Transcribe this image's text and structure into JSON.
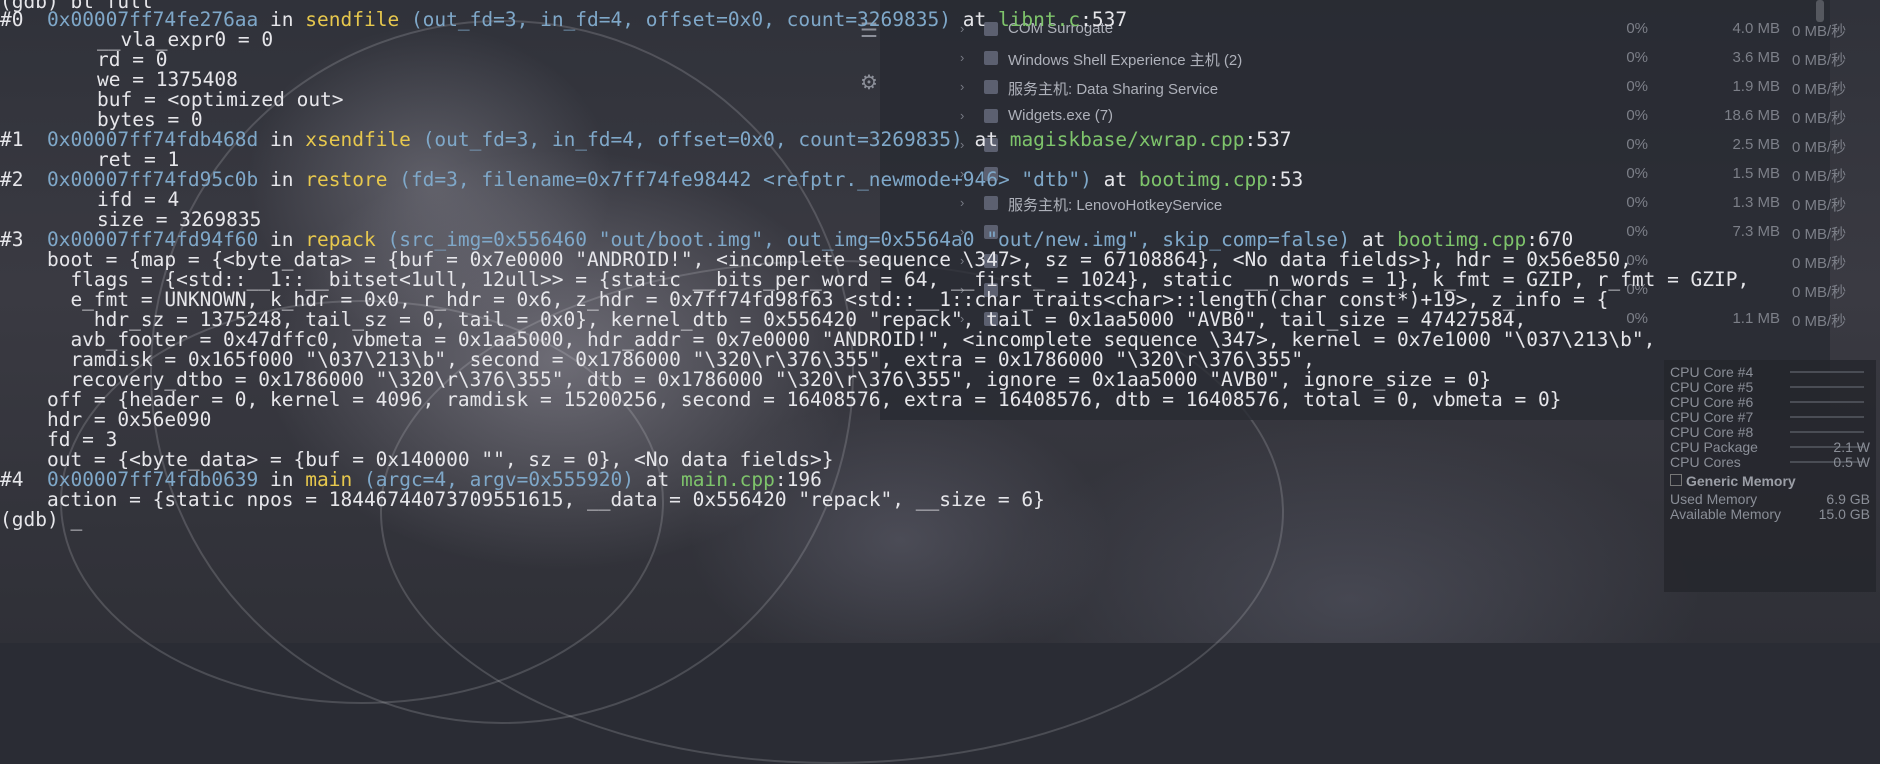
{
  "taskmgr": {
    "processes": [
      {
        "name": "COM Surrogate",
        "cpu": "0%",
        "mem": "4.0 MB",
        "disk": "0 MB/秒"
      },
      {
        "name": "Windows Shell Experience 主机 (2)",
        "cpu": "0%",
        "mem": "3.6 MB",
        "disk": "0 MB/秒"
      },
      {
        "name": "服务主机: Data Sharing Service",
        "cpu": "0%",
        "mem": "1.9 MB",
        "disk": "0 MB/秒"
      },
      {
        "name": "Widgets.exe (7)",
        "cpu": "0%",
        "mem": "18.6 MB",
        "disk": "0 MB/秒"
      },
      {
        "name": "",
        "cpu": "0%",
        "mem": "2.5 MB",
        "disk": "0 MB/秒"
      },
      {
        "name": "",
        "cpu": "0%",
        "mem": "1.5 MB",
        "disk": "0 MB/秒"
      },
      {
        "name": "服务主机: LenovoHotkeyService",
        "cpu": "0%",
        "mem": "1.3 MB",
        "disk": "0 MB/秒"
      },
      {
        "name": "",
        "cpu": "0%",
        "mem": "7.3 MB",
        "disk": "0 MB/秒"
      },
      {
        "name": "",
        "cpu": "0%",
        "mem": "",
        "disk": "0 MB/秒"
      },
      {
        "name": "",
        "cpu": "0%",
        "mem": "",
        "disk": "0 MB/秒"
      },
      {
        "name": "",
        "cpu": "0%",
        "mem": "1.1 MB",
        "disk": "0 MB/秒"
      }
    ]
  },
  "monitor": {
    "rows": [
      {
        "label": "CPU Core #4",
        "value": ""
      },
      {
        "label": "CPU Core #5",
        "value": ""
      },
      {
        "label": "CPU Core #6",
        "value": ""
      },
      {
        "label": "CPU Core #7",
        "value": ""
      },
      {
        "label": "CPU Core #8",
        "value": ""
      },
      {
        "label": "CPU Package",
        "value": "2.1 W"
      },
      {
        "label": "CPU Cores",
        "value": "0.5 W"
      }
    ],
    "section_title": "Generic Memory",
    "mem_rows": [
      {
        "label": "Used Memory",
        "value": "6.9 GB"
      },
      {
        "label": "Available Memory",
        "value": "15.0 GB"
      }
    ]
  },
  "terminal": {
    "first_line": "(gdb) bt full",
    "prompt": "(gdb) _",
    "frame0": {
      "num": "#0",
      "addr": "0x00007ff74fe276aa",
      "fn": "sendfile",
      "args": "(out_fd=3, in_fd=4, offset=0x0, count=3269835)",
      "file": "libnt.c",
      "line": ":537"
    },
    "frame0_locals": [
      "__vla_expr0 = 0",
      "rd = 0",
      "we = 1375408",
      "buf = <optimized out>",
      "bytes = 0"
    ],
    "frame1": {
      "num": "#1",
      "addr": "0x00007ff74fdb468d",
      "fn": "xsendfile",
      "args": "(out_fd=3, in_fd=4, offset=0x0, count=3269835)",
      "file": "magiskbase/xwrap.cpp",
      "line": ":537"
    },
    "frame1_locals": [
      "ret = 1"
    ],
    "frame2": {
      "num": "#2",
      "addr": "0x00007ff74fd95c0b",
      "fn": "restore",
      "args": "(fd=3, filename=0x7ff74fe98442 <refptr._newmode+946> \"dtb\")",
      "file": "bootimg.cpp",
      "line": ":53"
    },
    "frame2_locals": [
      "ifd = 4",
      "size = 3269835"
    ],
    "frame3": {
      "num": "#3",
      "addr": "0x00007ff74fd94f60",
      "fn": "repack",
      "args": "(src_img=0x556460 \"out/boot.img\", out_img=0x5564a0 \"out/new.img\", skip_comp=false)",
      "file": "bootimg.cpp",
      "line": ":670"
    },
    "frame3_locals": [
      "    boot = {map = {<byte_data> = {buf = 0x7e0000 \"ANDROID!\", <incomplete sequence \\347>, sz = 67108864}, <No data fields>}, hdr = 0x56e850,",
      "      flags = {<std::__1::__bitset<1ull, 12ull>> = {static __bits_per_word = 64, __first_ = 1024}, static __n_words = 1}, k_fmt = GZIP, r_fmt = GZIP,",
      "      e_fmt = UNKNOWN, k_hdr = 0x0, r_hdr = 0x6, z_hdr = 0x7ff74fd98f63 <std::__1::char_traits<char>::length(char const*)+19>, z_info = {",
      "        hdr_sz = 1375248, tail_sz = 0, tail = 0x0}, kernel_dtb = 0x556420 \"repack\", tail = 0x1aa5000 \"AVB0\", tail_size = 47427584,",
      "      avb_footer = 0x47dffc0, vbmeta = 0x1aa5000, hdr_addr = 0x7e0000 \"ANDROID!\", <incomplete sequence \\347>, kernel = 0x7e1000 \"\\037\\213\\b\",",
      "      ramdisk = 0x165f000 \"\\037\\213\\b\", second = 0x1786000 \"\\320\\r\\376\\355\", extra = 0x1786000 \"\\320\\r\\376\\355\",",
      "      recovery_dtbo = 0x1786000 \"\\320\\r\\376\\355\", dtb = 0x1786000 \"\\320\\r\\376\\355\", ignore = 0x1aa5000 \"AVB0\", ignore_size = 0}",
      "    off = {header = 0, kernel = 4096, ramdisk = 15200256, second = 16408576, extra = 16408576, dtb = 16408576, total = 0, vbmeta = 0}",
      "    hdr = 0x56e090",
      "    fd = 3",
      "    out = {<byte_data> = {buf = 0x140000 \"\", sz = 0}, <No data fields>}"
    ],
    "frame4": {
      "num": "#4",
      "addr": "0x00007ff74fdb0639",
      "fn": "main",
      "args": "(argc=4, argv=0x555920)",
      "file": "main.cpp",
      "line": ":196"
    },
    "frame4_locals": [
      "    action = {static npos = 18446744073709551615, __data = 0x556420 \"repack\", __size = 6}"
    ]
  }
}
